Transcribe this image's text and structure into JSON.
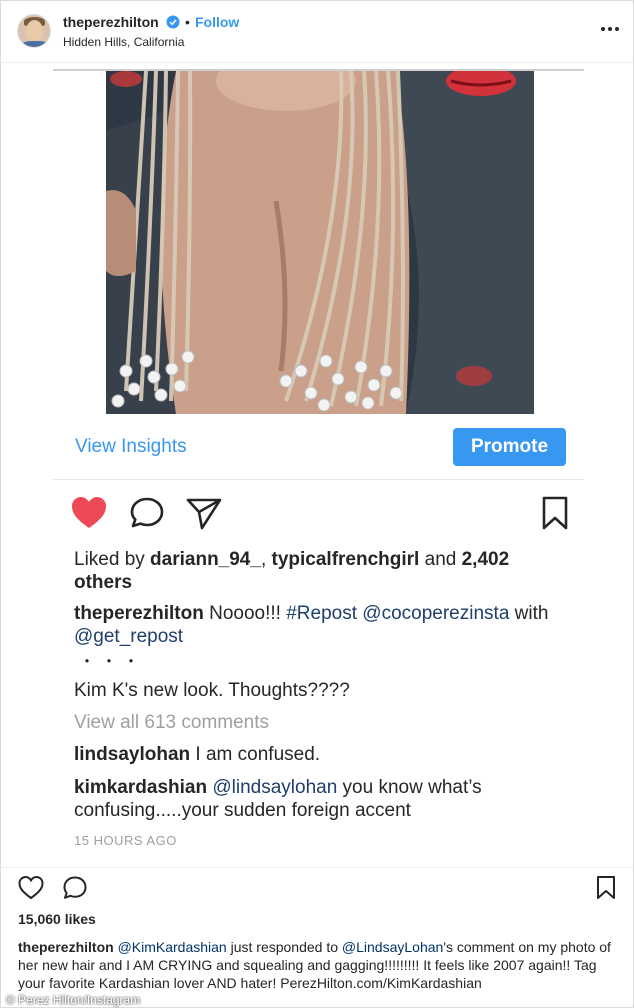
{
  "header": {
    "username": "theperezhilton",
    "separator": "•",
    "follow_label": "Follow",
    "location": "Hidden Hills, California",
    "more_icon": "more-options-icon"
  },
  "embedded_post": {
    "view_insights_label": "View Insights",
    "promote_label": "Promote",
    "likes": {
      "prefix": "Liked by ",
      "user1": "dariann_94_",
      "sep": ", ",
      "user2": "typicalfrenchgirl",
      "middle": " and ",
      "count": "2,402 others"
    },
    "caption": {
      "username": "theperezhilton",
      "text1": " Noooo!!! ",
      "hashtag": "#Repost",
      "space": " ",
      "mention1": "@cocoperezinsta",
      "text2": " with ",
      "mention2": "@get_repost"
    },
    "ellipsis": "・・・",
    "question": "Kim K's new look. Thoughts????",
    "view_all_comments": "View all 613 comments",
    "comments": [
      {
        "username": "lindsaylohan",
        "text": " I am confused."
      },
      {
        "username": "kimkardashian",
        "mention": "@lindsaylohan",
        "text": " you know what’s confusing.....your sudden foreign accent"
      }
    ],
    "time_ago": "15 HOURS AGO"
  },
  "outer_post": {
    "likes": "15,060 likes",
    "caption": {
      "username": "theperezhilton",
      "mention1": "@KimKardashian",
      "text1": " just responded to ",
      "mention2": "@LindsayLohan",
      "text2": "'s comment on my photo of her new hair and I AM CRYING and squealing and gagging!!!!!!!!! It feels like 2007 again!! Tag your favorite Kardashian lover AND hater! PerezHilton.com/KimKardashian"
    }
  },
  "credit": "© Perez Hilton/Instagram",
  "colors": {
    "accent_blue": "#3897f0",
    "like_red": "#ed4956",
    "link_navy": "#1e3f6b"
  }
}
